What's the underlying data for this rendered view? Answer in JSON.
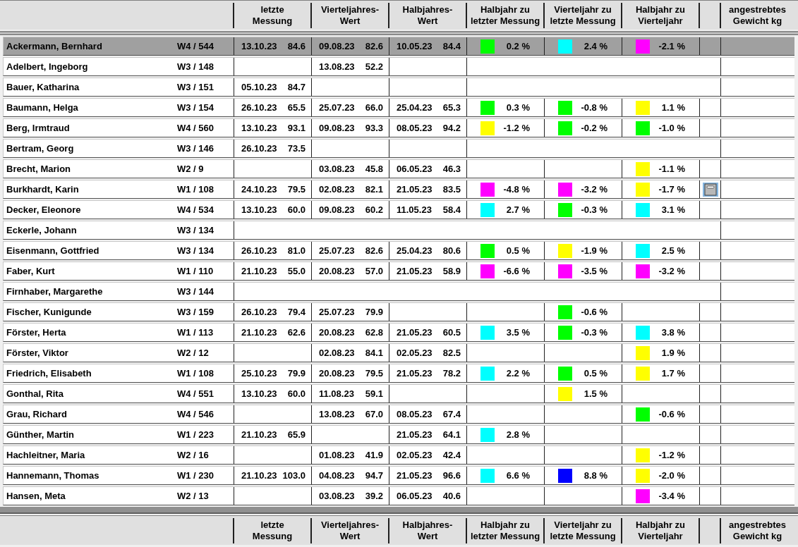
{
  "header": [
    "letzte Messung",
    "Vierteljahres-Wert",
    "Halbjahres-Wert",
    "Halbjahr zu letzter Messung",
    "Vierteljahr zu letzte Messung",
    "Halbjahr  zu Vierteljahr",
    "angestrebtes Gewicht kg"
  ],
  "rows": [
    {
      "name": "Ackermann, Bernhard",
      "ward": "W4 / 544",
      "selected": true,
      "last": {
        "date": "13.10.23",
        "value": "84.6"
      },
      "quarter": {
        "date": "09.08.23",
        "value": "82.6"
      },
      "half": {
        "date": "10.05.23",
        "value": "84.4"
      },
      "half_to_last": {
        "color": "#00ff00",
        "value": "0.2 %"
      },
      "quarter_to_last": {
        "color": "#00ffff",
        "value": "2.4 %"
      },
      "half_to_quarter": {
        "color": "#ff00ff",
        "value": "-2.1 %"
      }
    },
    {
      "name": "Adelbert, Ingeborg",
      "ward": "W3 / 148",
      "selected": false,
      "quarter": {
        "date": "13.08.23",
        "value": "52.2"
      }
    },
    {
      "name": "Bauer, Katharina",
      "ward": "W3 / 151",
      "selected": false,
      "last": {
        "date": "05.10.23",
        "value": "84.7"
      }
    },
    {
      "name": "Baumann, Helga",
      "ward": "W3 / 154",
      "selected": false,
      "last": {
        "date": "26.10.23",
        "value": "65.5"
      },
      "quarter": {
        "date": "25.07.23",
        "value": "66.0"
      },
      "half": {
        "date": "25.04.23",
        "value": "65.3"
      },
      "half_to_last": {
        "color": "#00ff00",
        "value": "0.3 %"
      },
      "quarter_to_last": {
        "color": "#00ff00",
        "value": "-0.8 %"
      },
      "half_to_quarter": {
        "color": "#ffff00",
        "value": "1.1 %"
      }
    },
    {
      "name": "Berg, Irmtraud",
      "ward": "W4 / 560",
      "selected": false,
      "last": {
        "date": "13.10.23",
        "value": "93.1"
      },
      "quarter": {
        "date": "09.08.23",
        "value": "93.3"
      },
      "half": {
        "date": "08.05.23",
        "value": "94.2"
      },
      "half_to_last": {
        "color": "#ffff00",
        "value": "-1.2 %"
      },
      "quarter_to_last": {
        "color": "#00ff00",
        "value": "-0.2 %"
      },
      "half_to_quarter": {
        "color": "#00ff00",
        "value": "-1.0 %"
      }
    },
    {
      "name": "Bertram, Georg",
      "ward": "W3 / 146",
      "selected": false,
      "last": {
        "date": "26.10.23",
        "value": "73.5"
      }
    },
    {
      "name": "Brecht, Marion",
      "ward": "W2 / 9",
      "selected": false,
      "quarter": {
        "date": "03.08.23",
        "value": "45.8"
      },
      "half": {
        "date": "06.05.23",
        "value": "46.3"
      },
      "half_to_quarter": {
        "color": "#ffff00",
        "value": "-1.1 %"
      }
    },
    {
      "name": "Burkhardt, Karin",
      "ward": "W1 / 108",
      "selected": false,
      "action_button": {
        "kind": "box"
      },
      "last": {
        "date": "24.10.23",
        "value": "79.5"
      },
      "quarter": {
        "date": "02.08.23",
        "value": "82.1"
      },
      "half": {
        "date": "21.05.23",
        "value": "83.5"
      },
      "half_to_last": {
        "color": "#ff00ff",
        "value": "-4.8 %"
      },
      "quarter_to_last": {
        "color": "#ff00ff",
        "value": "-3.2 %"
      },
      "half_to_quarter": {
        "color": "#ffff00",
        "value": "-1.7 %"
      }
    },
    {
      "name": "Decker, Eleonore",
      "ward": "W4 / 534",
      "selected": false,
      "last": {
        "date": "13.10.23",
        "value": "60.0"
      },
      "quarter": {
        "date": "09.08.23",
        "value": "60.2"
      },
      "half": {
        "date": "11.05.23",
        "value": "58.4"
      },
      "half_to_last": {
        "color": "#00ffff",
        "value": "2.7 %"
      },
      "quarter_to_last": {
        "color": "#00ff00",
        "value": "-0.3 %"
      },
      "half_to_quarter": {
        "color": "#00ffff",
        "value": "3.1 %"
      }
    },
    {
      "name": "Eckerle, Johann",
      "ward": "W3 / 134",
      "selected": false
    },
    {
      "name": "Eisenmann, Gottfried",
      "ward": "W3 / 134",
      "selected": false,
      "last": {
        "date": "26.10.23",
        "value": "81.0"
      },
      "quarter": {
        "date": "25.07.23",
        "value": "82.6"
      },
      "half": {
        "date": "25.04.23",
        "value": "80.6"
      },
      "half_to_last": {
        "color": "#00ff00",
        "value": "0.5 %"
      },
      "quarter_to_last": {
        "color": "#ffff00",
        "value": "-1.9 %"
      },
      "half_to_quarter": {
        "color": "#00ffff",
        "value": "2.5 %"
      }
    },
    {
      "name": "Faber, Kurt",
      "ward": "W1 / 110",
      "selected": false,
      "last": {
        "date": "21.10.23",
        "value": "55.0"
      },
      "quarter": {
        "date": "20.08.23",
        "value": "57.0"
      },
      "half": {
        "date": "21.05.23",
        "value": "58.9"
      },
      "half_to_last": {
        "color": "#ff00ff",
        "value": "-6.6 %"
      },
      "quarter_to_last": {
        "color": "#ff00ff",
        "value": "-3.5 %"
      },
      "half_to_quarter": {
        "color": "#ff00ff",
        "value": "-3.2 %"
      }
    },
    {
      "name": "Firnhaber, Margarethe",
      "ward": "W3 / 144",
      "selected": false
    },
    {
      "name": "Fischer, Kunigunde",
      "ward": "W3 / 159",
      "selected": false,
      "last": {
        "date": "26.10.23",
        "value": "79.4"
      },
      "quarter": {
        "date": "25.07.23",
        "value": "79.9"
      },
      "quarter_to_last": {
        "color": "#00ff00",
        "value": "-0.6 %"
      }
    },
    {
      "name": "Förster, Herta",
      "ward": "W1 / 113",
      "selected": false,
      "last": {
        "date": "21.10.23",
        "value": "62.6"
      },
      "quarter": {
        "date": "20.08.23",
        "value": "62.8"
      },
      "half": {
        "date": "21.05.23",
        "value": "60.5"
      },
      "half_to_last": {
        "color": "#00ffff",
        "value": "3.5 %"
      },
      "quarter_to_last": {
        "color": "#00ff00",
        "value": "-0.3 %"
      },
      "half_to_quarter": {
        "color": "#00ffff",
        "value": "3.8 %"
      }
    },
    {
      "name": "Förster, Viktor",
      "ward": "W2 / 12",
      "selected": false,
      "quarter": {
        "date": "02.08.23",
        "value": "84.1"
      },
      "half": {
        "date": "02.05.23",
        "value": "82.5"
      },
      "half_to_quarter": {
        "color": "#ffff00",
        "value": "1.9 %"
      }
    },
    {
      "name": "Friedrich, Elisabeth",
      "ward": "W1 / 108",
      "selected": false,
      "last": {
        "date": "25.10.23",
        "value": "79.9"
      },
      "quarter": {
        "date": "20.08.23",
        "value": "79.5"
      },
      "half": {
        "date": "21.05.23",
        "value": "78.2"
      },
      "half_to_last": {
        "color": "#00ffff",
        "value": "2.2 %"
      },
      "quarter_to_last": {
        "color": "#00ff00",
        "value": "0.5 %"
      },
      "half_to_quarter": {
        "color": "#ffff00",
        "value": "1.7 %"
      }
    },
    {
      "name": "Gonthal, Rita",
      "ward": "W4 / 551",
      "selected": false,
      "last": {
        "date": "13.10.23",
        "value": "60.0"
      },
      "quarter": {
        "date": "11.08.23",
        "value": "59.1"
      },
      "quarter_to_last": {
        "color": "#ffff00",
        "value": "1.5 %"
      }
    },
    {
      "name": "Grau, Richard",
      "ward": "W4 / 546",
      "selected": false,
      "quarter": {
        "date": "13.08.23",
        "value": "67.0"
      },
      "half": {
        "date": "08.05.23",
        "value": "67.4"
      },
      "half_to_quarter": {
        "color": "#00ff00",
        "value": "-0.6 %"
      }
    },
    {
      "name": "Günther, Martin",
      "ward": "W1 / 223",
      "selected": false,
      "last": {
        "date": "21.10.23",
        "value": "65.9"
      },
      "half": {
        "date": "21.05.23",
        "value": "64.1"
      },
      "half_to_last": {
        "color": "#00ffff",
        "value": "2.8 %"
      }
    },
    {
      "name": "Hachleitner, Maria",
      "ward": "W2 / 16",
      "selected": false,
      "quarter": {
        "date": "01.08.23",
        "value": "41.9"
      },
      "half": {
        "date": "02.05.23",
        "value": "42.4"
      },
      "half_to_quarter": {
        "color": "#ffff00",
        "value": "-1.2 %"
      }
    },
    {
      "name": "Hannemann, Thomas",
      "ward": "W1 / 230",
      "selected": false,
      "last": {
        "date": "21.10.23",
        "value": "103.0"
      },
      "quarter": {
        "date": "04.08.23",
        "value": "94.7"
      },
      "half": {
        "date": "21.05.23",
        "value": "96.6"
      },
      "half_to_last": {
        "color": "#00ffff",
        "value": "6.6 %"
      },
      "quarter_to_last": {
        "color": "#0000ff",
        "value": "8.8 %"
      },
      "half_to_quarter": {
        "color": "#ffff00",
        "value": "-2.0 %"
      }
    },
    {
      "name": "Hansen, Meta",
      "ward": "W2 / 13",
      "selected": false,
      "quarter": {
        "date": "03.08.23",
        "value": "39.2"
      },
      "half": {
        "date": "06.05.23",
        "value": "40.6"
      },
      "half_to_quarter": {
        "color": "#ff00ff",
        "value": "-3.4 %"
      }
    }
  ],
  "footer_header": [
    "letzte Messung",
    "Vierteljahres-Wert",
    "Halbjahres-Wert",
    "Halbjahr zu letzter Messung",
    "Vierteljahr zu letzte Messung",
    "Halbjahr  zu Vierteljahr",
    "angestrebtes Gewicht kg"
  ]
}
